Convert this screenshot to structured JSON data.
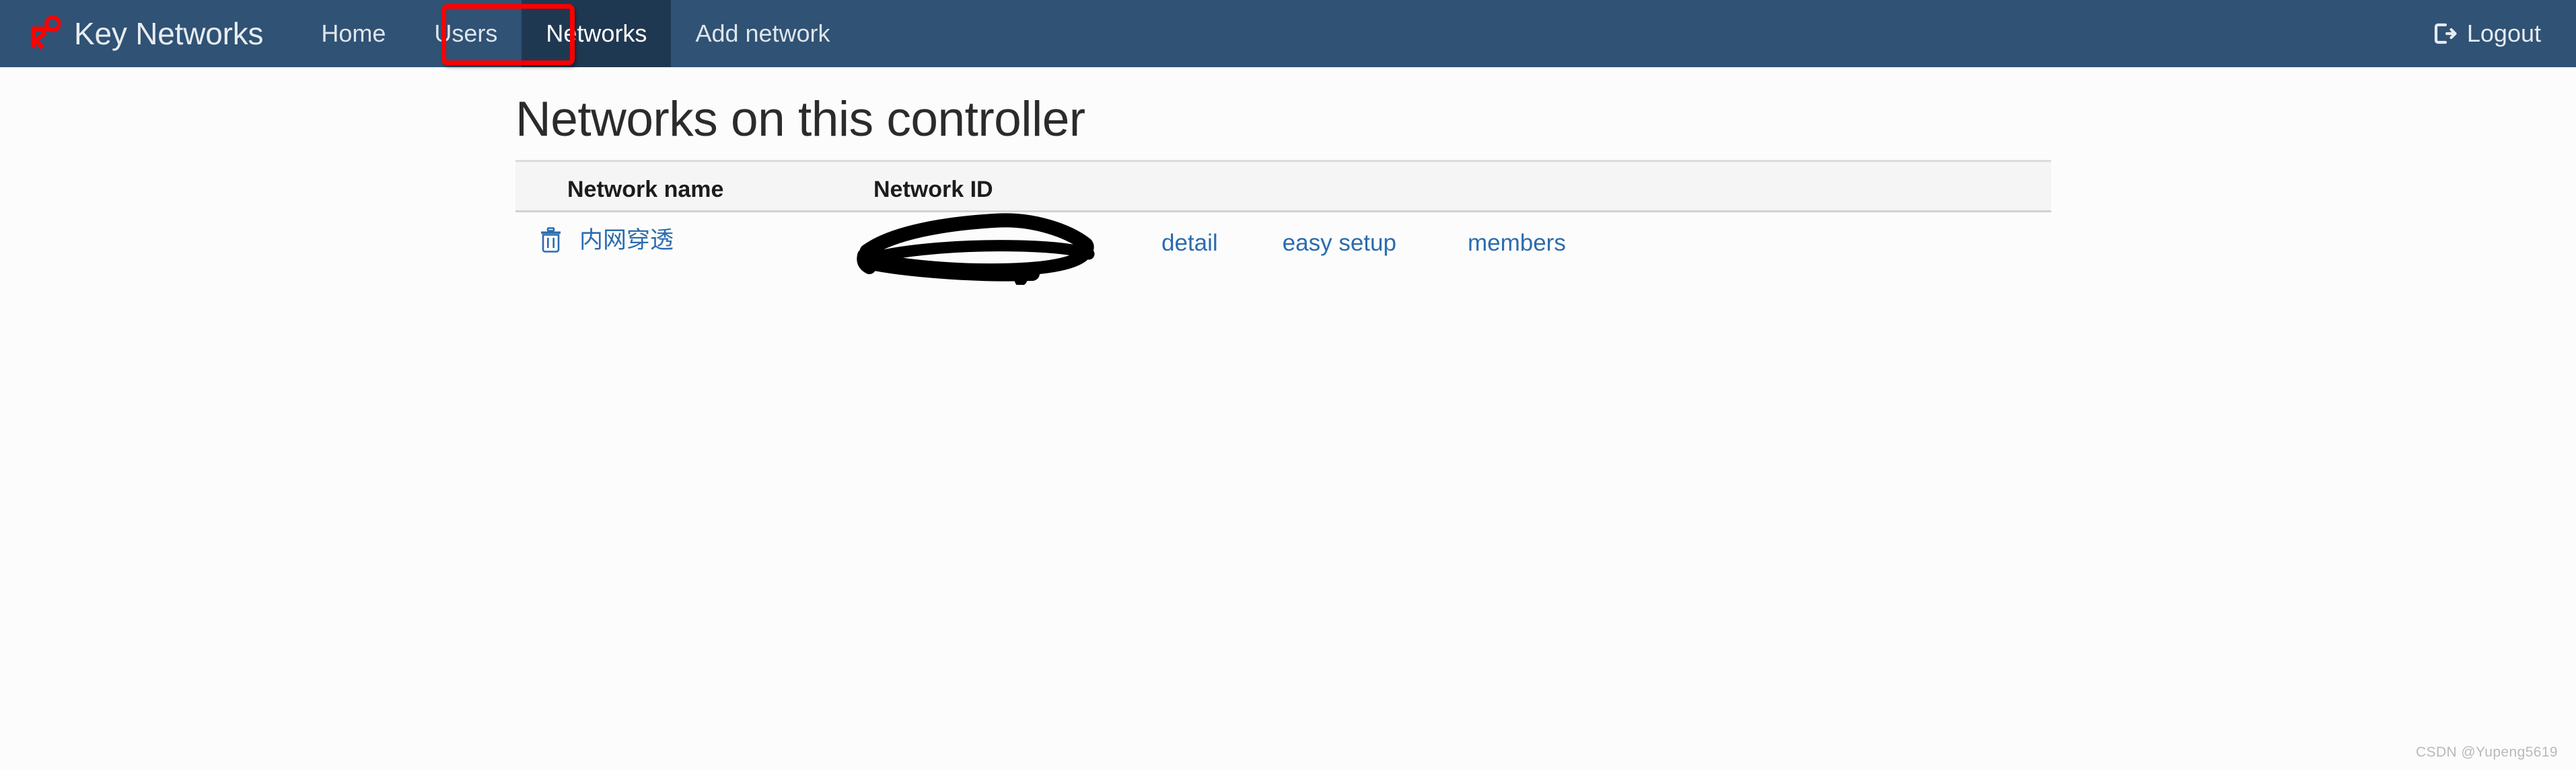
{
  "navbar": {
    "brand": {
      "label": "Key Networks",
      "icon": "key-icon",
      "color": "#fe0000"
    },
    "background_color": "#2f5275",
    "active_background_color": "#1f3851",
    "links": [
      {
        "label": "Home",
        "active": false
      },
      {
        "label": "Users",
        "active": false
      },
      {
        "label": "Networks",
        "active": true
      },
      {
        "label": "Add network",
        "active": false
      }
    ],
    "logout": {
      "label": "Logout",
      "icon": "sign-out-icon"
    },
    "annotation": {
      "shape": "rectangle",
      "color": "#fe0000",
      "targets": "Networks"
    }
  },
  "main": {
    "page_title": "Networks on this controller",
    "table": {
      "columns": [
        "Network name",
        "Network ID"
      ],
      "rows": [
        {
          "delete_icon": "trash-icon",
          "network_name": "内网穿透",
          "network_id": "",
          "network_id_redacted": true,
          "actions": [
            "detail",
            "easy setup",
            "members"
          ]
        }
      ]
    }
  },
  "watermark": {
    "text": "CSDN @Yupeng5619"
  },
  "colors": {
    "link_blue": "#2b6caf",
    "navbar_blue": "#2f5275",
    "active_tab": "#1f3851",
    "annotation_red": "#fe0000",
    "page_background": "#fcfcfc",
    "table_header_background": "#f5f5f5"
  }
}
